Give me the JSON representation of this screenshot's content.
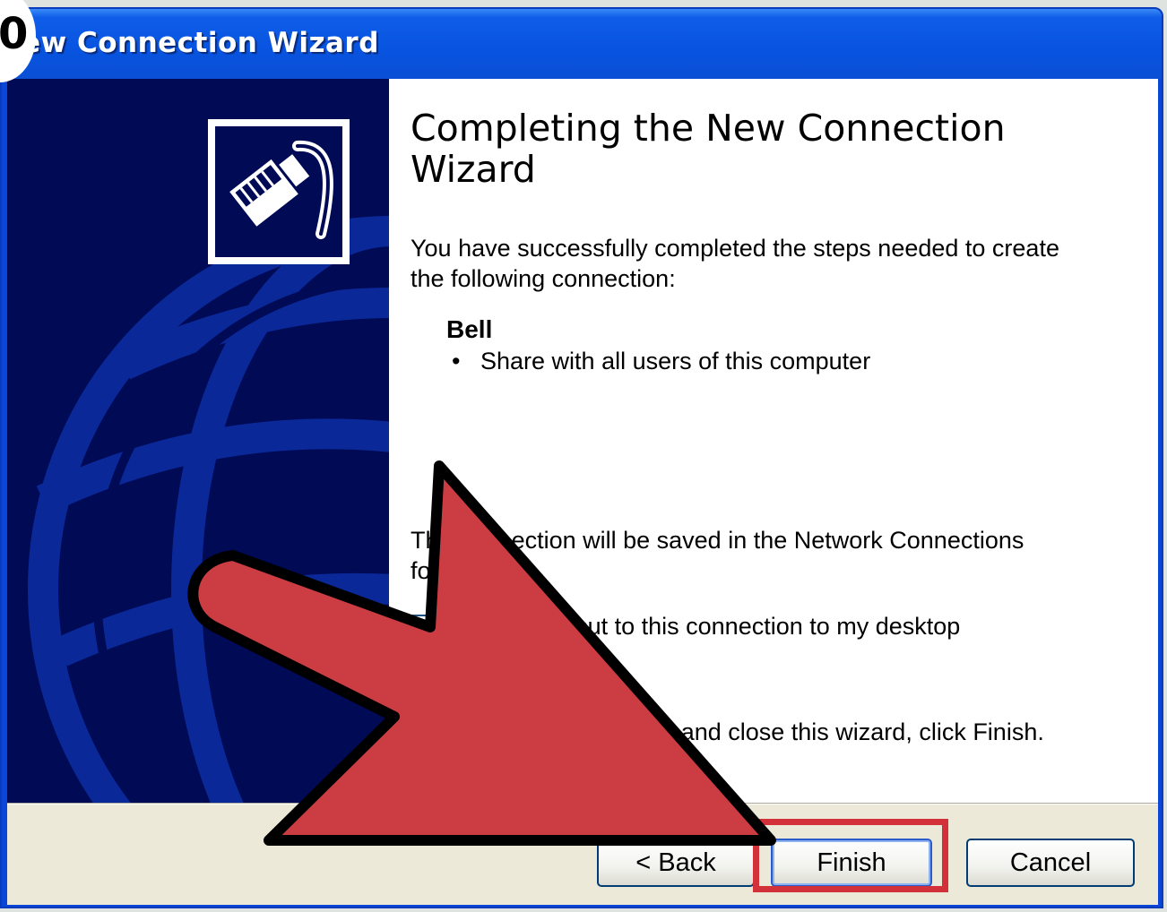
{
  "window": {
    "title": "New Connection Wizard",
    "title_visible": "ew Connection Wizard"
  },
  "step_badge": {
    "number": "0"
  },
  "wizard": {
    "heading": "Completing the New Connection Wizard",
    "intro": "You have successfully completed the steps needed to create the following connection:",
    "connection_name": "Bell",
    "connection_details": [
      "Share with all users of this computer"
    ],
    "save_note": "The connection will be saved in the Network Connections folder.",
    "shortcut_checkbox": {
      "label": "Add a shortcut to this connection to my desktop",
      "checked": false
    },
    "finish_instruction": "To create the connection and close this wizard, click Finish."
  },
  "buttons": {
    "back": "< Back",
    "finish": "Finish",
    "cancel": "Cancel"
  },
  "colors": {
    "title_bar": "#0a4fd4",
    "side_panel": "#000a55",
    "globe_lines": "#0c2a9c",
    "dialog_face": "#ece9d8",
    "annotation_arrow": "#cc3d43",
    "annotation_highlight": "#d3313a"
  },
  "icons": {
    "wizard_image": "network-cable-icon",
    "side_art": "globe-graphic"
  }
}
